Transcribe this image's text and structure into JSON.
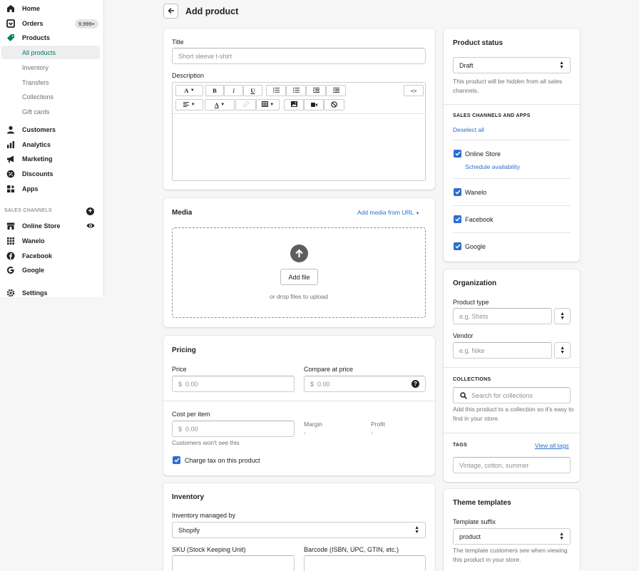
{
  "sidebar": {
    "items": [
      {
        "label": "Home",
        "icon": "home-icon"
      },
      {
        "label": "Orders",
        "icon": "orders-icon",
        "badge": "9,999+"
      },
      {
        "label": "Products",
        "icon": "tag-icon"
      },
      {
        "label": "Customers",
        "icon": "person-icon"
      },
      {
        "label": "Analytics",
        "icon": "bar-chart-icon"
      },
      {
        "label": "Marketing",
        "icon": "megaphone-icon"
      },
      {
        "label": "Discounts",
        "icon": "discount-icon"
      },
      {
        "label": "Apps",
        "icon": "apps-icon"
      }
    ],
    "product_sub": [
      "All products",
      "Inventory",
      "Transfers",
      "Collections",
      "Gift cards"
    ],
    "sales_channels_label": "SALES CHANNELS",
    "channels": [
      {
        "label": "Online Store",
        "icon": "store-icon"
      },
      {
        "label": "Wanelo",
        "icon": "grid-icon"
      },
      {
        "label": "Facebook",
        "icon": "facebook-icon"
      },
      {
        "label": "Google",
        "icon": "google-icon"
      }
    ],
    "settings": "Settings"
  },
  "header": {
    "title": "Add product"
  },
  "product_card": {
    "title_label": "Title",
    "title_placeholder": "Short sleeve t-shirt",
    "description_label": "Description"
  },
  "media": {
    "title": "Media",
    "add_url": "Add media from URL",
    "add_file": "Add file",
    "drop_hint": "or drop files to upload"
  },
  "pricing": {
    "title": "Pricing",
    "price_label": "Price",
    "price_value": "0.00",
    "compare_label": "Compare at price",
    "compare_value": "0.00",
    "currency": "$",
    "cost_label": "Cost per item",
    "cost_value": "0.00",
    "margin_label": "Margin",
    "margin_value": "-",
    "profit_label": "Profit",
    "profit_value": "-",
    "cost_note": "Customers won't see this",
    "charge_tax": "Charge tax on this product"
  },
  "inventory": {
    "title": "Inventory",
    "managed_label": "Inventory managed by",
    "managed_value": "Shopify",
    "sku_label": "SKU (Stock Keeping Unit)",
    "barcode_label": "Barcode (ISBN, UPC, GTIN, etc.)"
  },
  "status": {
    "title": "Product status",
    "value": "Draft",
    "note": "This product will be hidden from all sales channels.",
    "channels_heading": "SALES CHANNELS AND APPS",
    "deselect": "Deselect all",
    "channels": [
      "Online Store",
      "Wanelo",
      "Facebook",
      "Google"
    ],
    "schedule": "Schedule availability"
  },
  "organization": {
    "title": "Organization",
    "type_label": "Product type",
    "type_placeholder": "e.g. Shirts",
    "vendor_label": "Vendor",
    "vendor_placeholder": "e.g. Nike",
    "collections_heading": "COLLECTIONS",
    "collections_placeholder": "Search for collections",
    "collections_note": "Add this product to a collection so it's easy to find in your store.",
    "tags_heading": "TAGS",
    "view_tags": "View all tags",
    "tags_placeholder": "Vintage, cotton, summer"
  },
  "theme": {
    "title": "Theme templates",
    "suffix_label": "Template suffix",
    "suffix_value": "product",
    "note": "The template customers see when viewing this product in your store."
  },
  "colors": {
    "accent": "#2c6ecb",
    "active_green": "#008060"
  }
}
